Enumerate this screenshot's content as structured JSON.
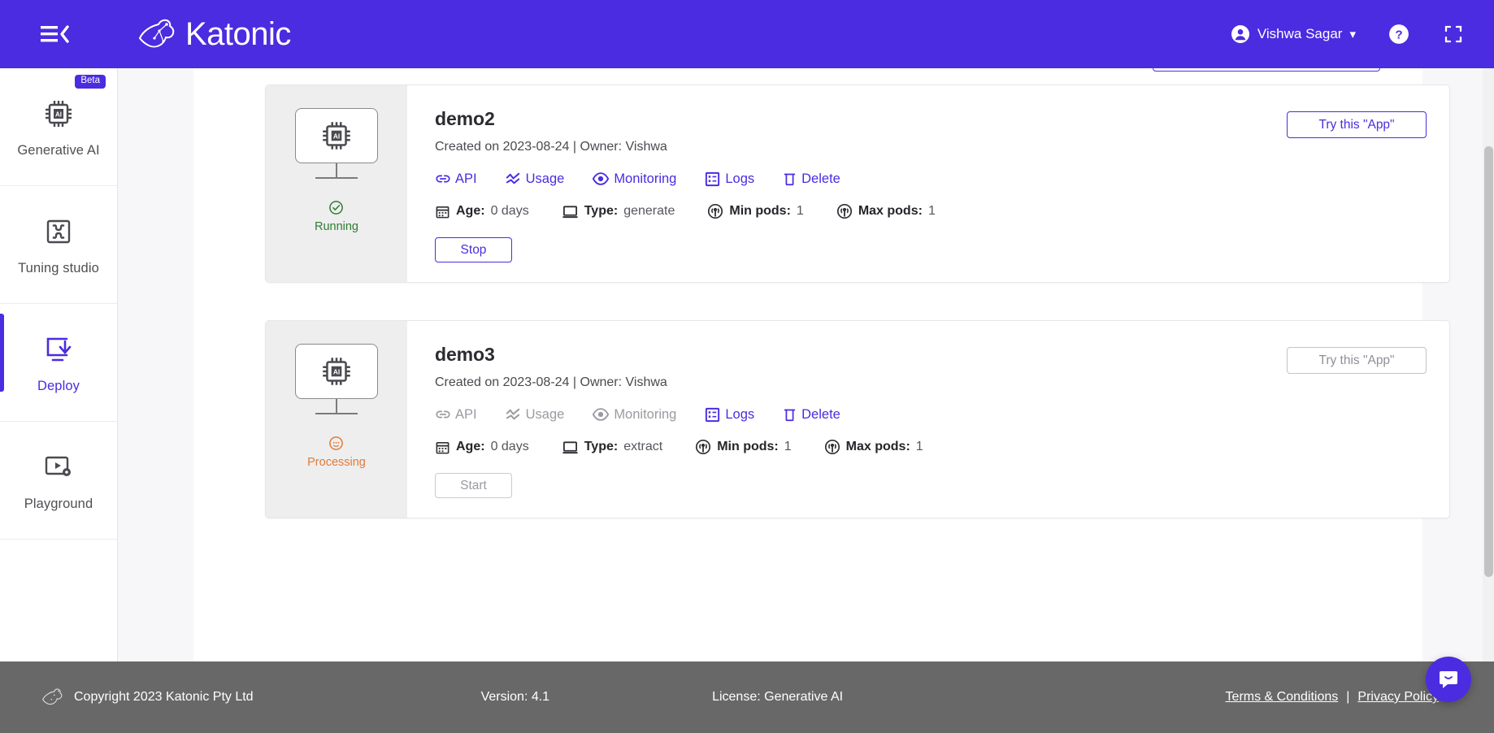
{
  "header": {
    "menu_icon": "hamburger-collapse-icon",
    "brand": "Katonic",
    "user_name": "Vishwa Sagar",
    "chevron": "▾",
    "help_icon": "help-circle-icon",
    "fullscreen_icon": "fullscreen-icon",
    "bg_color": "#4B2CE0"
  },
  "sidebar": {
    "items": [
      {
        "label": "Generative AI",
        "icon": "ai-chip-icon",
        "badge": "Beta",
        "active": false
      },
      {
        "label": "Tuning studio",
        "icon": "puzzle-icon",
        "badge": "",
        "active": false
      },
      {
        "label": "Deploy",
        "icon": "deploy-download-icon",
        "badge": "",
        "active": true
      },
      {
        "label": "Playground",
        "icon": "play-settings-icon",
        "badge": "",
        "active": false
      }
    ]
  },
  "deployments": [
    {
      "name": "demo2",
      "created": "Created on 2023-08-24 | Owner: Vishwa",
      "status": "Running",
      "status_icon": "check-circle-icon",
      "status_color": "#2e7d32",
      "enabled": true,
      "try_label": "Try this \"App\"",
      "control_label": "Stop",
      "actions": [
        {
          "label": "API",
          "icon": "link-icon"
        },
        {
          "label": "Usage",
          "icon": "usage-chart-icon"
        },
        {
          "label": "Monitoring",
          "icon": "eye-icon"
        },
        {
          "label": "Logs",
          "icon": "logs-list-icon"
        },
        {
          "label": "Delete",
          "icon": "trash-icon"
        }
      ],
      "meta": [
        {
          "icon": "calendar-icon",
          "key": "Age:",
          "value": "0 days"
        },
        {
          "icon": "monitor-icon",
          "key": "Type:",
          "value": "generate"
        },
        {
          "icon": "pods-icon",
          "key": "Min pods:",
          "value": "1"
        },
        {
          "icon": "pods-icon",
          "key": "Max pods:",
          "value": "1"
        }
      ]
    },
    {
      "name": "demo3",
      "created": "Created on 2023-08-24 | Owner: Vishwa",
      "status": "Processing",
      "status_icon": "processing-circle-icon",
      "status_color": "#e07b39",
      "enabled": false,
      "try_label": "Try this \"App\"",
      "control_label": "Start",
      "actions": [
        {
          "label": "API",
          "icon": "link-icon"
        },
        {
          "label": "Usage",
          "icon": "usage-chart-icon"
        },
        {
          "label": "Monitoring",
          "icon": "eye-icon"
        },
        {
          "label": "Logs",
          "icon": "logs-list-icon"
        },
        {
          "label": "Delete",
          "icon": "trash-icon"
        }
      ],
      "meta": [
        {
          "icon": "calendar-icon",
          "key": "Age:",
          "value": "0 days"
        },
        {
          "icon": "monitor-icon",
          "key": "Type:",
          "value": "extract"
        },
        {
          "icon": "pods-icon",
          "key": "Min pods:",
          "value": "1"
        },
        {
          "icon": "pods-icon",
          "key": "Max pods:",
          "value": "1"
        }
      ]
    }
  ],
  "footer": {
    "copyright": "Copyright 2023 Katonic Pty Ltd",
    "version": "Version: 4.1",
    "license": "License: Generative AI",
    "terms": "Terms & Conditions",
    "separator": "|",
    "privacy": "Privacy Policy",
    "bg_color": "#686868"
  },
  "chat": {
    "icon": "chat-bubble-icon"
  }
}
